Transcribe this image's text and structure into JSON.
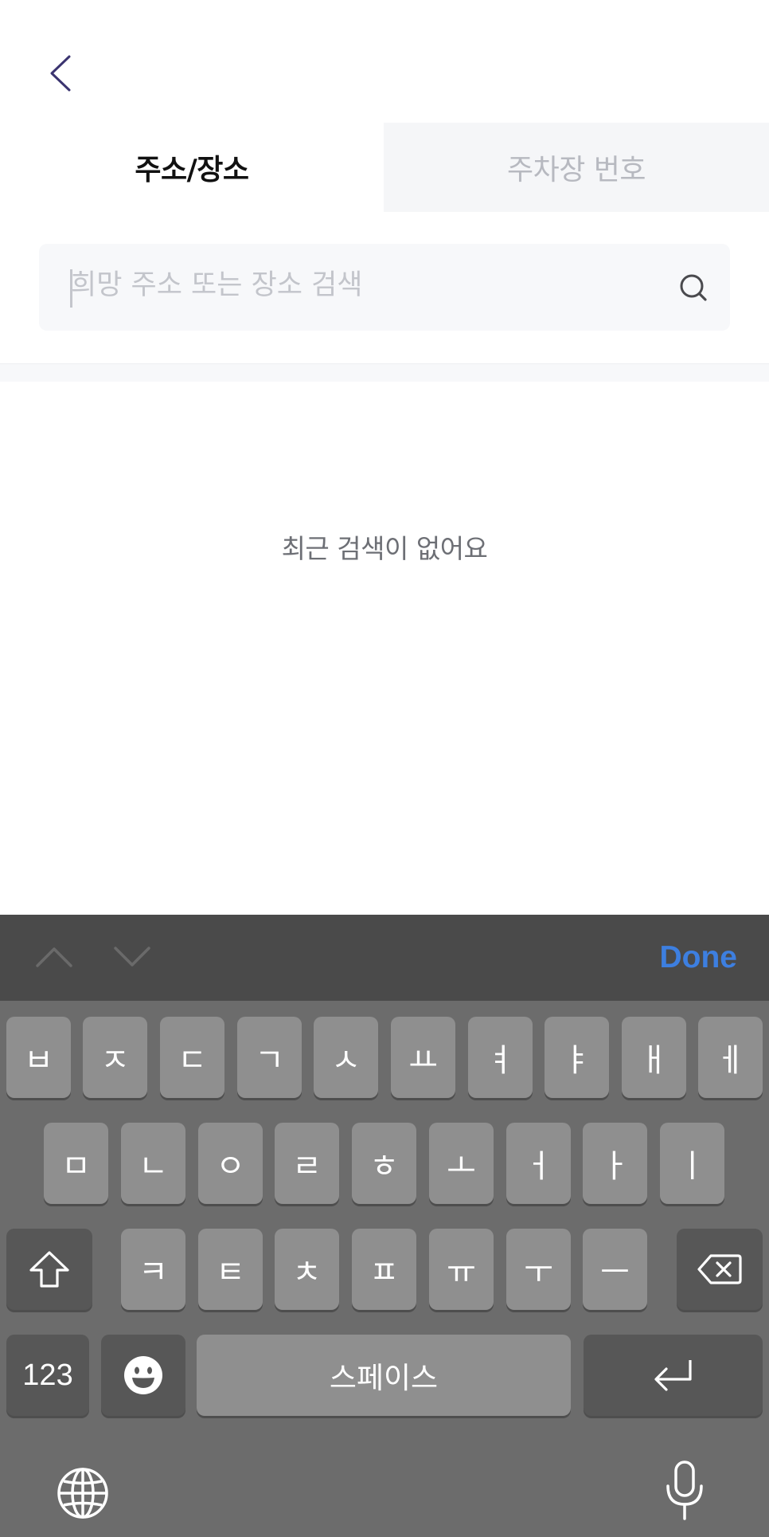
{
  "header": {
    "back_icon": "chevron-left-icon"
  },
  "tabs": [
    {
      "label": "주소/장소",
      "active": true
    },
    {
      "label": "주차장 번호",
      "active": false
    }
  ],
  "search": {
    "placeholder": "희망 주소 또는 장소 검색",
    "value": "",
    "icon": "search-icon"
  },
  "empty_state": {
    "message": "최근 검색이 없어요"
  },
  "keyboard_toolbar": {
    "done_label": "Done"
  },
  "keyboard": {
    "row1": [
      "ㅂ",
      "ㅈ",
      "ㄷ",
      "ㄱ",
      "ㅅ",
      "ㅛ",
      "ㅕ",
      "ㅑ",
      "ㅐ",
      "ㅔ"
    ],
    "row2": [
      "ㅁ",
      "ㄴ",
      "ㅇ",
      "ㄹ",
      "ㅎ",
      "ㅗ",
      "ㅓ",
      "ㅏ",
      "ㅣ"
    ],
    "row3": [
      "ㅋ",
      "ㅌ",
      "ㅊ",
      "ㅍ",
      "ㅠ",
      "ㅜ",
      "ㅡ"
    ],
    "numbers_label": "123",
    "space_label": "스페이스"
  },
  "colors": {
    "accent": "#3d7fe0",
    "back_chevron": "#3b3470",
    "inactive_tab_text": "#b7b9c0",
    "keyboard_bg": "#6c6c6c"
  }
}
